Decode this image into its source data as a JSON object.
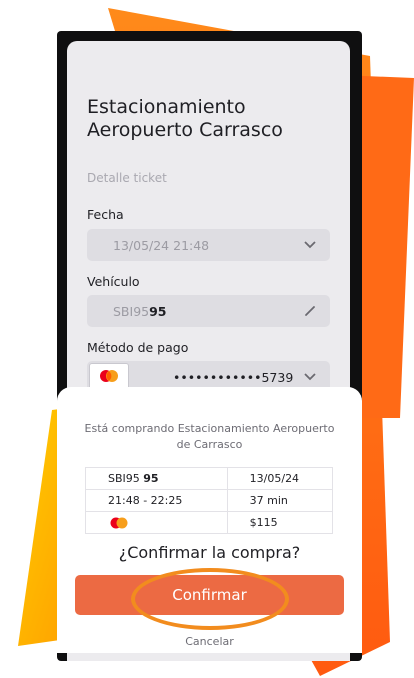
{
  "app": {
    "title_line1": "Estacionamiento",
    "title_line2": "Aeropuerto Carrasco",
    "section": "Detalle ticket"
  },
  "form": {
    "fecha_label": "Fecha",
    "fecha_value": "13/05/24 21:48",
    "vehiculo_label": "Vehículo",
    "vehiculo_value_prefix": "SBI95",
    "vehiculo_value_suffix": "95",
    "metodo_label": "Método de pago",
    "metodo_value": "••••••••••••5739"
  },
  "sheet": {
    "message": "Está comprando Estacionamiento Aeropuerto de Carrasco",
    "summary": {
      "plate_prefix": "SBI95",
      "plate_suffix": "95",
      "date": "13/05/24",
      "time_range": "21:48 - 22:25",
      "duration": "37 min",
      "amount": "$115"
    },
    "question": "¿Confirmar la compra?",
    "confirm_label": "Confirmar",
    "cancel_label": "Cancelar"
  },
  "icons": {
    "fecha": "chevron-down-icon",
    "vehiculo": "pencil-icon",
    "metodo": "chevron-down-icon",
    "card": "mastercard-icon"
  },
  "colors": {
    "accent": "#ec6a43",
    "highlight_circle": "#f28c1e",
    "stripe_orange": "#ff6a1a",
    "stripe_yellow": "#ffbf00"
  }
}
